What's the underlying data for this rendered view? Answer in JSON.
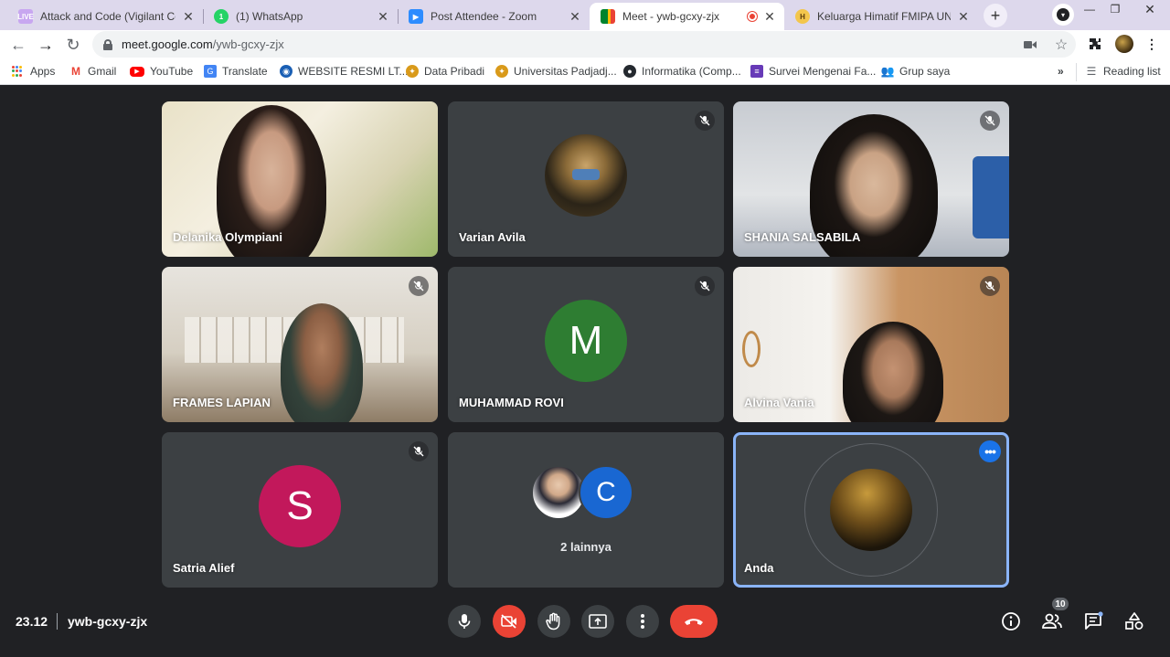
{
  "browser": {
    "tabs": [
      {
        "title": "Attack and Code (Vigilant Code",
        "favicon": "live-icon",
        "color": "#c8a7f0"
      },
      {
        "title": "(1) WhatsApp",
        "favicon": "whatsapp-icon",
        "color": "#25d366"
      },
      {
        "title": "Post Attendee - Zoom",
        "favicon": "zoom-icon",
        "color": "#2d8cff"
      },
      {
        "title": "Meet - ywb-gcxy-zjx",
        "favicon": "meet-icon",
        "color": "#00832d",
        "active": true
      },
      {
        "title": "Keluarga Himatif FMIPA UNPAD",
        "favicon": "himatif-icon",
        "color": "#6b4a1a"
      }
    ],
    "address": {
      "host": "meet.google.com",
      "path": "/ywb-gcxy-zjx"
    },
    "bookmarks": [
      {
        "label": "Apps",
        "icon": "apps-grid-icon"
      },
      {
        "label": "Gmail",
        "icon": "gmail-icon"
      },
      {
        "label": "YouTube",
        "icon": "youtube-icon"
      },
      {
        "label": "Translate",
        "icon": "translate-icon"
      },
      {
        "label": "WEBSITE RESMI LT...",
        "icon": "globe-icon"
      },
      {
        "label": "Data Pribadi",
        "icon": "unpad-icon"
      },
      {
        "label": "Universitas Padjadj...",
        "icon": "unpad-icon"
      },
      {
        "label": "Informatika (Comp...",
        "icon": "github-icon"
      },
      {
        "label": "Survei Mengenai Fa...",
        "icon": "forms-icon"
      },
      {
        "label": "Grup saya",
        "icon": "group-icon"
      }
    ],
    "overflow": "»",
    "reading_list": "Reading list"
  },
  "meet": {
    "participants": [
      {
        "name": "Delanika Olympiani",
        "type": "video",
        "muted": false
      },
      {
        "name": "Varian Avila",
        "type": "photo",
        "muted": true
      },
      {
        "name": "SHANIA SALSABILA",
        "type": "video",
        "muted": true
      },
      {
        "name": "FRAMES LAPIAN",
        "type": "video",
        "muted": true
      },
      {
        "name": "MUHAMMAD ROVI",
        "type": "letter",
        "letter": "M",
        "color": "#2e7d32",
        "muted": true
      },
      {
        "name": "Alvina Vania",
        "type": "video",
        "muted": true
      },
      {
        "name": "Satria Alief",
        "type": "letter",
        "letter": "S",
        "color": "#c2185b",
        "muted": true
      }
    ],
    "others": {
      "label": "2 lainnya",
      "letter": "C",
      "color": "#1967d2"
    },
    "self": {
      "name": "Anda"
    },
    "time": "23.12",
    "meeting_code": "ywb-gcxy-zjx",
    "people_count": "10"
  }
}
